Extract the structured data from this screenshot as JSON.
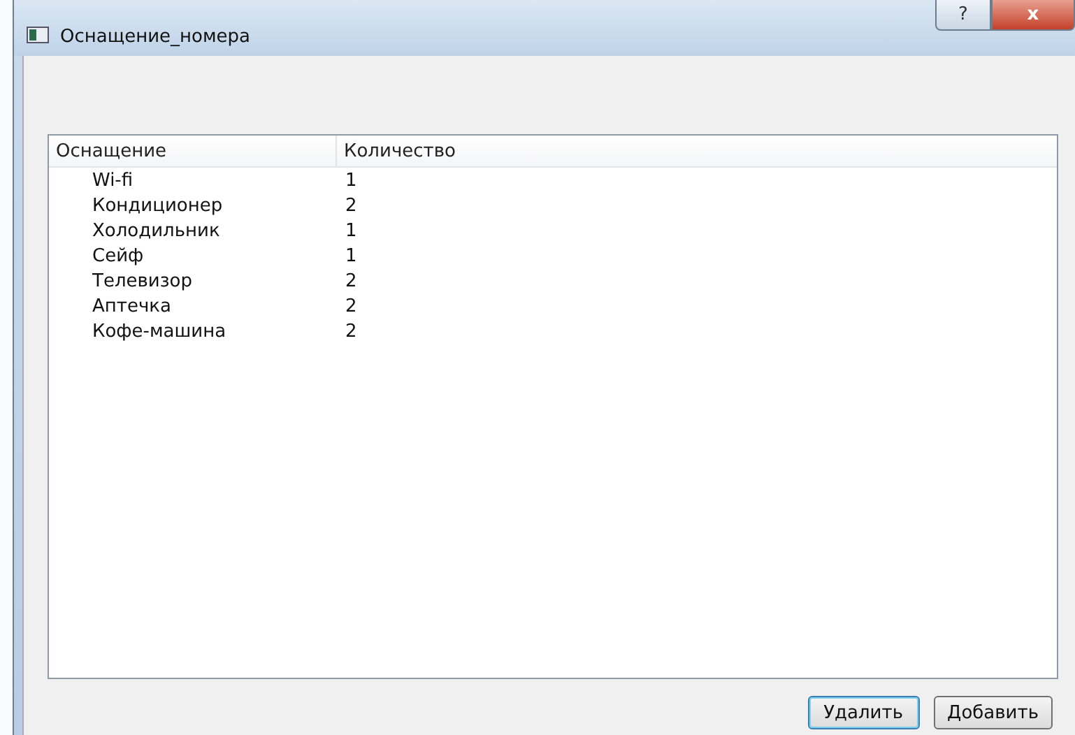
{
  "window": {
    "title": "Оснащение_номера",
    "help_button": "?",
    "close_button": "x"
  },
  "table": {
    "columns": [
      "Оснащение",
      "Количество"
    ],
    "rows": [
      {
        "name": "Wi-fi",
        "count": "1"
      },
      {
        "name": "Кондиционер",
        "count": "2"
      },
      {
        "name": "Холодильник",
        "count": "1"
      },
      {
        "name": "Сейф",
        "count": "1"
      },
      {
        "name": "Телевизор",
        "count": "2"
      },
      {
        "name": "Аптечка",
        "count": "2"
      },
      {
        "name": "Кофе-машина",
        "count": "2"
      }
    ]
  },
  "buttons": [
    {
      "label": "Удалить",
      "focused": true
    },
    {
      "label": "Добавить",
      "focused": false
    }
  ]
}
